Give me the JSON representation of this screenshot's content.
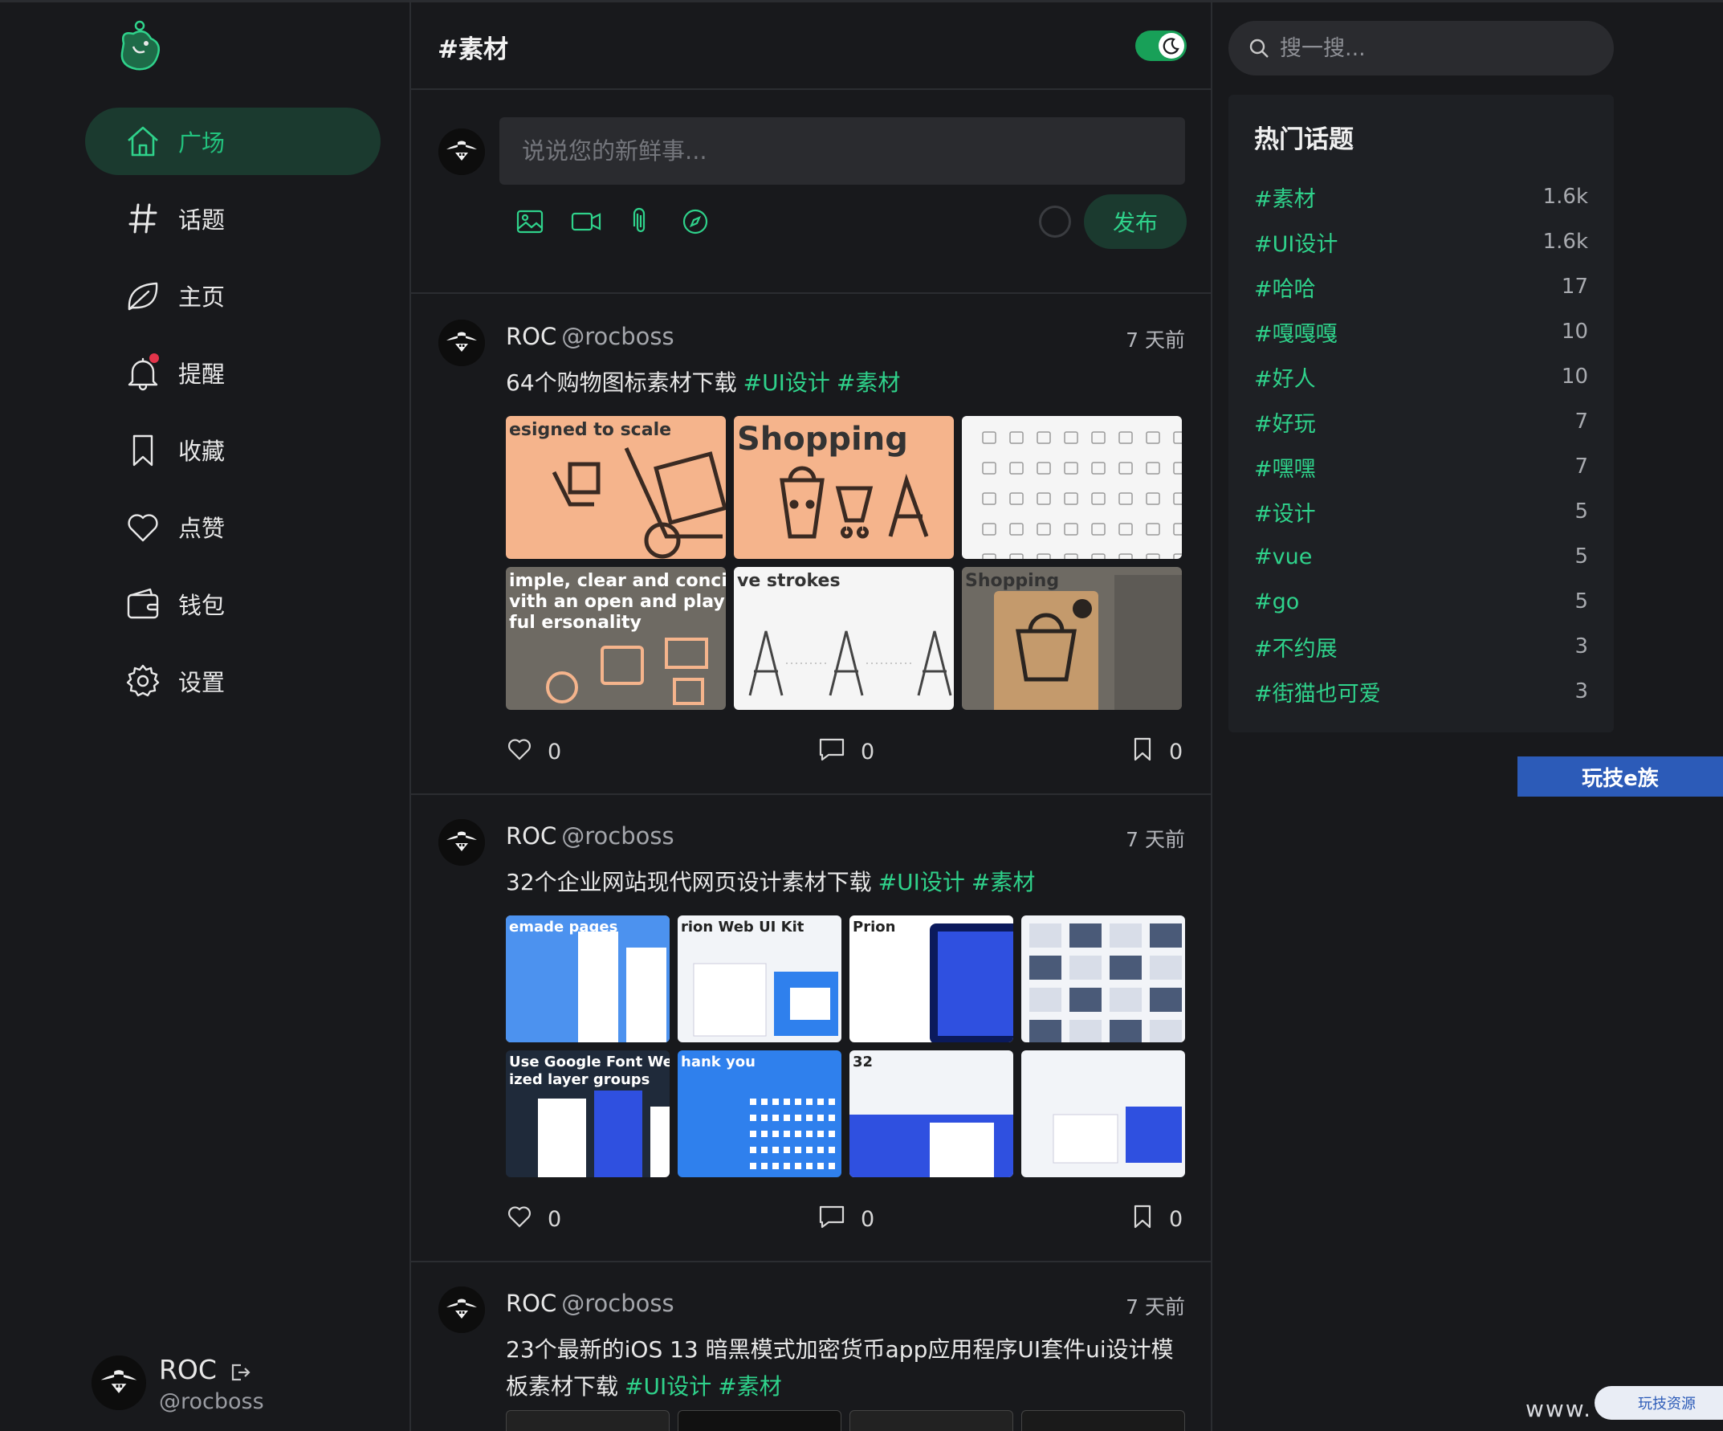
{
  "sidebar": {
    "items": [
      {
        "label": "广场",
        "icon": "home-icon",
        "active": true
      },
      {
        "label": "话题",
        "icon": "hash-icon"
      },
      {
        "label": "主页",
        "icon": "leaf-icon"
      },
      {
        "label": "提醒",
        "icon": "bell-icon"
      },
      {
        "label": "收藏",
        "icon": "bookmark-icon"
      },
      {
        "label": "点赞",
        "icon": "heart-icon"
      },
      {
        "label": "钱包",
        "icon": "wallet-icon"
      },
      {
        "label": "设置",
        "icon": "gear-icon"
      }
    ],
    "user": {
      "name": "ROC",
      "handle": "@rocboss"
    }
  },
  "header": {
    "title": "#素材",
    "dark_mode": true
  },
  "composer": {
    "placeholder": "说说您的新鲜事...",
    "publish_label": "发布"
  },
  "posts": [
    {
      "name": "ROC",
      "handle": "@rocboss",
      "time": "7 天前",
      "text": "64个购物图标素材下载",
      "tags": [
        "#UI设计",
        "#素材"
      ],
      "images": [
        {
          "caption": "esigned to scale"
        },
        {
          "caption": "Shopping"
        },
        {
          "caption": ""
        },
        {
          "caption": "imple, clear and concise, vith an open and playful ersonality"
        },
        {
          "caption": "ve strokes"
        },
        {
          "caption": "Shopping"
        }
      ],
      "likes": "0",
      "comments": "0",
      "collections": "0"
    },
    {
      "name": "ROC",
      "handle": "@rocboss",
      "time": "7 天前",
      "text": "32个企业网站现代网页设计素材下载",
      "tags": [
        "#UI设计",
        "#素材"
      ],
      "images": [
        {
          "caption": "emade pages"
        },
        {
          "caption": "rion Web UI Kit"
        },
        {
          "caption": "Prion"
        },
        {
          "caption": ""
        },
        {
          "caption": "Use Google Font Well organized layer groups"
        },
        {
          "caption": "hank you"
        },
        {
          "caption": "32"
        },
        {
          "caption": ""
        }
      ],
      "likes": "0",
      "comments": "0",
      "collections": "0"
    },
    {
      "name": "ROC",
      "handle": "@rocboss",
      "time": "7 天前",
      "text": "23个最新的iOS 13 暗黑模式加密货币app应用程序UI套件ui设计模板素材下载",
      "tags": [
        "#UI设计",
        "#素材"
      ]
    }
  ],
  "search": {
    "placeholder": "搜一搜..."
  },
  "hot_topics": {
    "title": "热门话题",
    "items": [
      {
        "name": "#素材",
        "count": "1.6k"
      },
      {
        "name": "#UI设计",
        "count": "1.6k"
      },
      {
        "name": "#哈哈",
        "count": "17"
      },
      {
        "name": "#嘎嘎嘎",
        "count": "10"
      },
      {
        "name": "#好人",
        "count": "10"
      },
      {
        "name": "#好玩",
        "count": "7"
      },
      {
        "name": "#嘿嘿",
        "count": "7"
      },
      {
        "name": "#设计",
        "count": "5"
      },
      {
        "name": "#vue",
        "count": "5"
      },
      {
        "name": "#go",
        "count": "5"
      },
      {
        "name": "#不约展",
        "count": "3"
      },
      {
        "name": "#街猫也可爱",
        "count": "3"
      }
    ]
  },
  "watermark": {
    "badge": "玩技e族",
    "site": "www.",
    "pill": "玩技资源"
  },
  "colors": {
    "accent": "#2fd28b",
    "accent_bg": "#1b3a2f",
    "bg": "#18191c",
    "panel": "#1e2024"
  }
}
